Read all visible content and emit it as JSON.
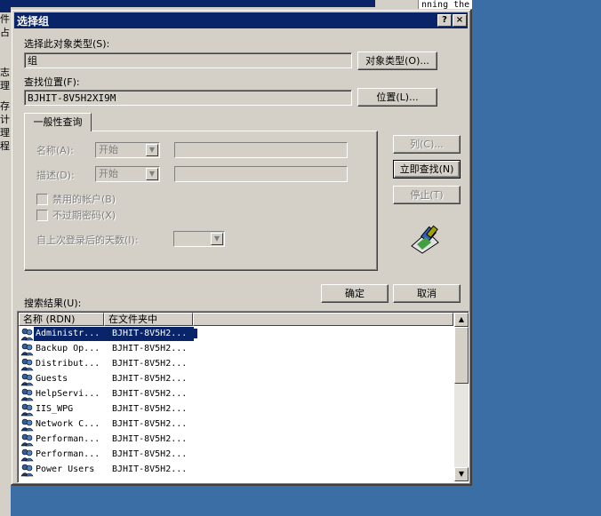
{
  "background_window": {
    "left_chars": [
      "件",
      "占",
      "志",
      "理",
      "存",
      "计",
      "理",
      "程"
    ],
    "right_text": "nning the"
  },
  "dialog": {
    "title": "选择组",
    "help_button": "?",
    "close_button": "×",
    "object_type_label": "选择此对象类型(S):",
    "object_type_value": "组",
    "object_type_button": "对象类型(O)...",
    "location_label": "查找位置(F):",
    "location_value": "BJHIT-8V5H2XI9M",
    "location_button": "位置(L)...",
    "tab_label": "一般性查询",
    "name_label": "名称(A):",
    "name_combo": "开始",
    "desc_label": "描述(D):",
    "desc_combo": "开始",
    "disabled_accounts": "禁用的帐户(B)",
    "non_expiring_pw": "不过期密码(X)",
    "days_since_logon": "自上次登录后的天数(I):",
    "columns_button": "列(C)...",
    "find_now_button": "立即查找(N)",
    "stop_button": "停止(T)",
    "ok_button": "确定",
    "cancel_button": "取消",
    "results_label": "搜索结果(U):"
  },
  "results": {
    "columns": [
      "名称 (RDN)",
      "在文件夹中"
    ],
    "rows": [
      {
        "name": "Administr...",
        "folder": "BJHIT-8V5H2..."
      },
      {
        "name": "Backup Op...",
        "folder": "BJHIT-8V5H2..."
      },
      {
        "name": "Distribut...",
        "folder": "BJHIT-8V5H2..."
      },
      {
        "name": "Guests",
        "folder": "BJHIT-8V5H2..."
      },
      {
        "name": "HelpServi...",
        "folder": "BJHIT-8V5H2..."
      },
      {
        "name": "IIS_WPG",
        "folder": "BJHIT-8V5H2..."
      },
      {
        "name": "Network C...",
        "folder": "BJHIT-8V5H2..."
      },
      {
        "name": "Performan...",
        "folder": "BJHIT-8V5H2..."
      },
      {
        "name": "Performan...",
        "folder": "BJHIT-8V5H2..."
      },
      {
        "name": "Power Users",
        "folder": "BJHIT-8V5H2..."
      }
    ]
  },
  "colors": {
    "desktop": "#3a6ea5",
    "titlebar": "#0a246a",
    "face": "#d4d0c8",
    "selection": "#0a246a"
  }
}
